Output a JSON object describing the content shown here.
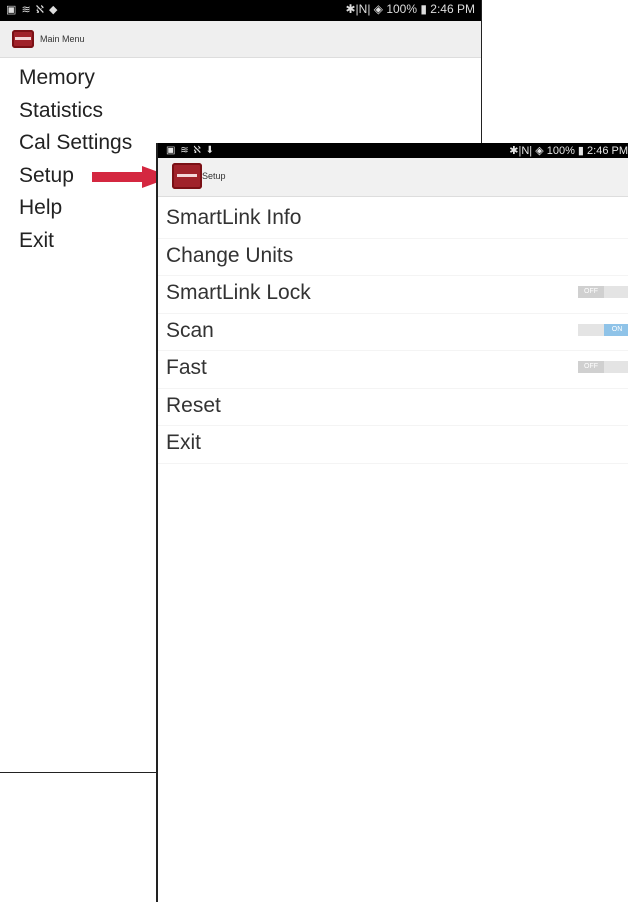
{
  "back_screen": {
    "status_left": "▣ ≋ ℵ ◆",
    "status_right": "✱|N| ◈ 100% ▮ 2:46 PM",
    "title": "Main Menu",
    "menu": [
      "Memory",
      "Statistics",
      "Cal Settings",
      "Setup",
      "Help",
      "Exit"
    ]
  },
  "front_screen": {
    "status_left": "▣ ≋ ℵ ⬇",
    "status_right": "✱|N| ◈ 100% ▮ 2:46 PM",
    "title": "Setup",
    "menu": [
      {
        "label": "SmartLink Info"
      },
      {
        "label": "Change Units"
      },
      {
        "label": "SmartLink Lock",
        "toggle": "OFF"
      },
      {
        "label": "Scan",
        "toggle": "ON"
      },
      {
        "label": "Fast",
        "toggle": "OFF"
      },
      {
        "label": "Reset"
      },
      {
        "label": "Exit"
      }
    ]
  },
  "colors": {
    "arrow": "#d42740",
    "toggle_on": "#8fc3e8",
    "app_icon": "#a0222a"
  }
}
